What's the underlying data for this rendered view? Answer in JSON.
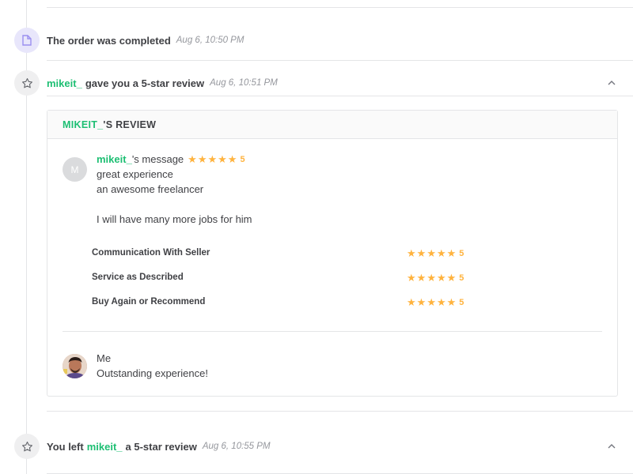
{
  "timeline": {
    "events": [
      {
        "text": "The order was completed",
        "time": "Aug 6, 10:50 PM",
        "icon": "document-icon"
      },
      {
        "user": "mikeit_",
        "text": "gave you a 5-star review",
        "time": "Aug 6, 10:51 PM",
        "icon": "star-outline-icon",
        "toggle_icon": "chevron-up-icon"
      },
      {
        "prefix": "You left",
        "user": "mikeit_",
        "text": "a 5-star review",
        "time": "Aug 6, 10:55 PM",
        "icon": "star-outline-icon",
        "toggle_icon": "chevron-up-icon"
      }
    ]
  },
  "review": {
    "header_user": "MIKEIT_",
    "header_suffix": "'S REVIEW",
    "buyer": {
      "avatar_letter": "M",
      "name": "mikeit_",
      "title_suffix": "'s message",
      "overall_rating": "5",
      "message_lines": [
        "great experience",
        "an awesome freelancer",
        "",
        "I will have many more jobs for him"
      ]
    },
    "ratings": [
      {
        "label": "Communication With Seller",
        "value": "5",
        "stars": 5
      },
      {
        "label": "Service as Described",
        "value": "5",
        "stars": 5
      },
      {
        "label": "Buy Again or Recommend",
        "value": "5",
        "stars": 5
      }
    ],
    "response": {
      "name": "Me",
      "text": "Outstanding experience!"
    }
  },
  "colors": {
    "accent_green": "#1dbf73",
    "star": "#ffb33e",
    "icon_purple_bg": "#e8e6fb",
    "icon_purple": "#9b8ff0",
    "border": "#e4e5e7"
  }
}
